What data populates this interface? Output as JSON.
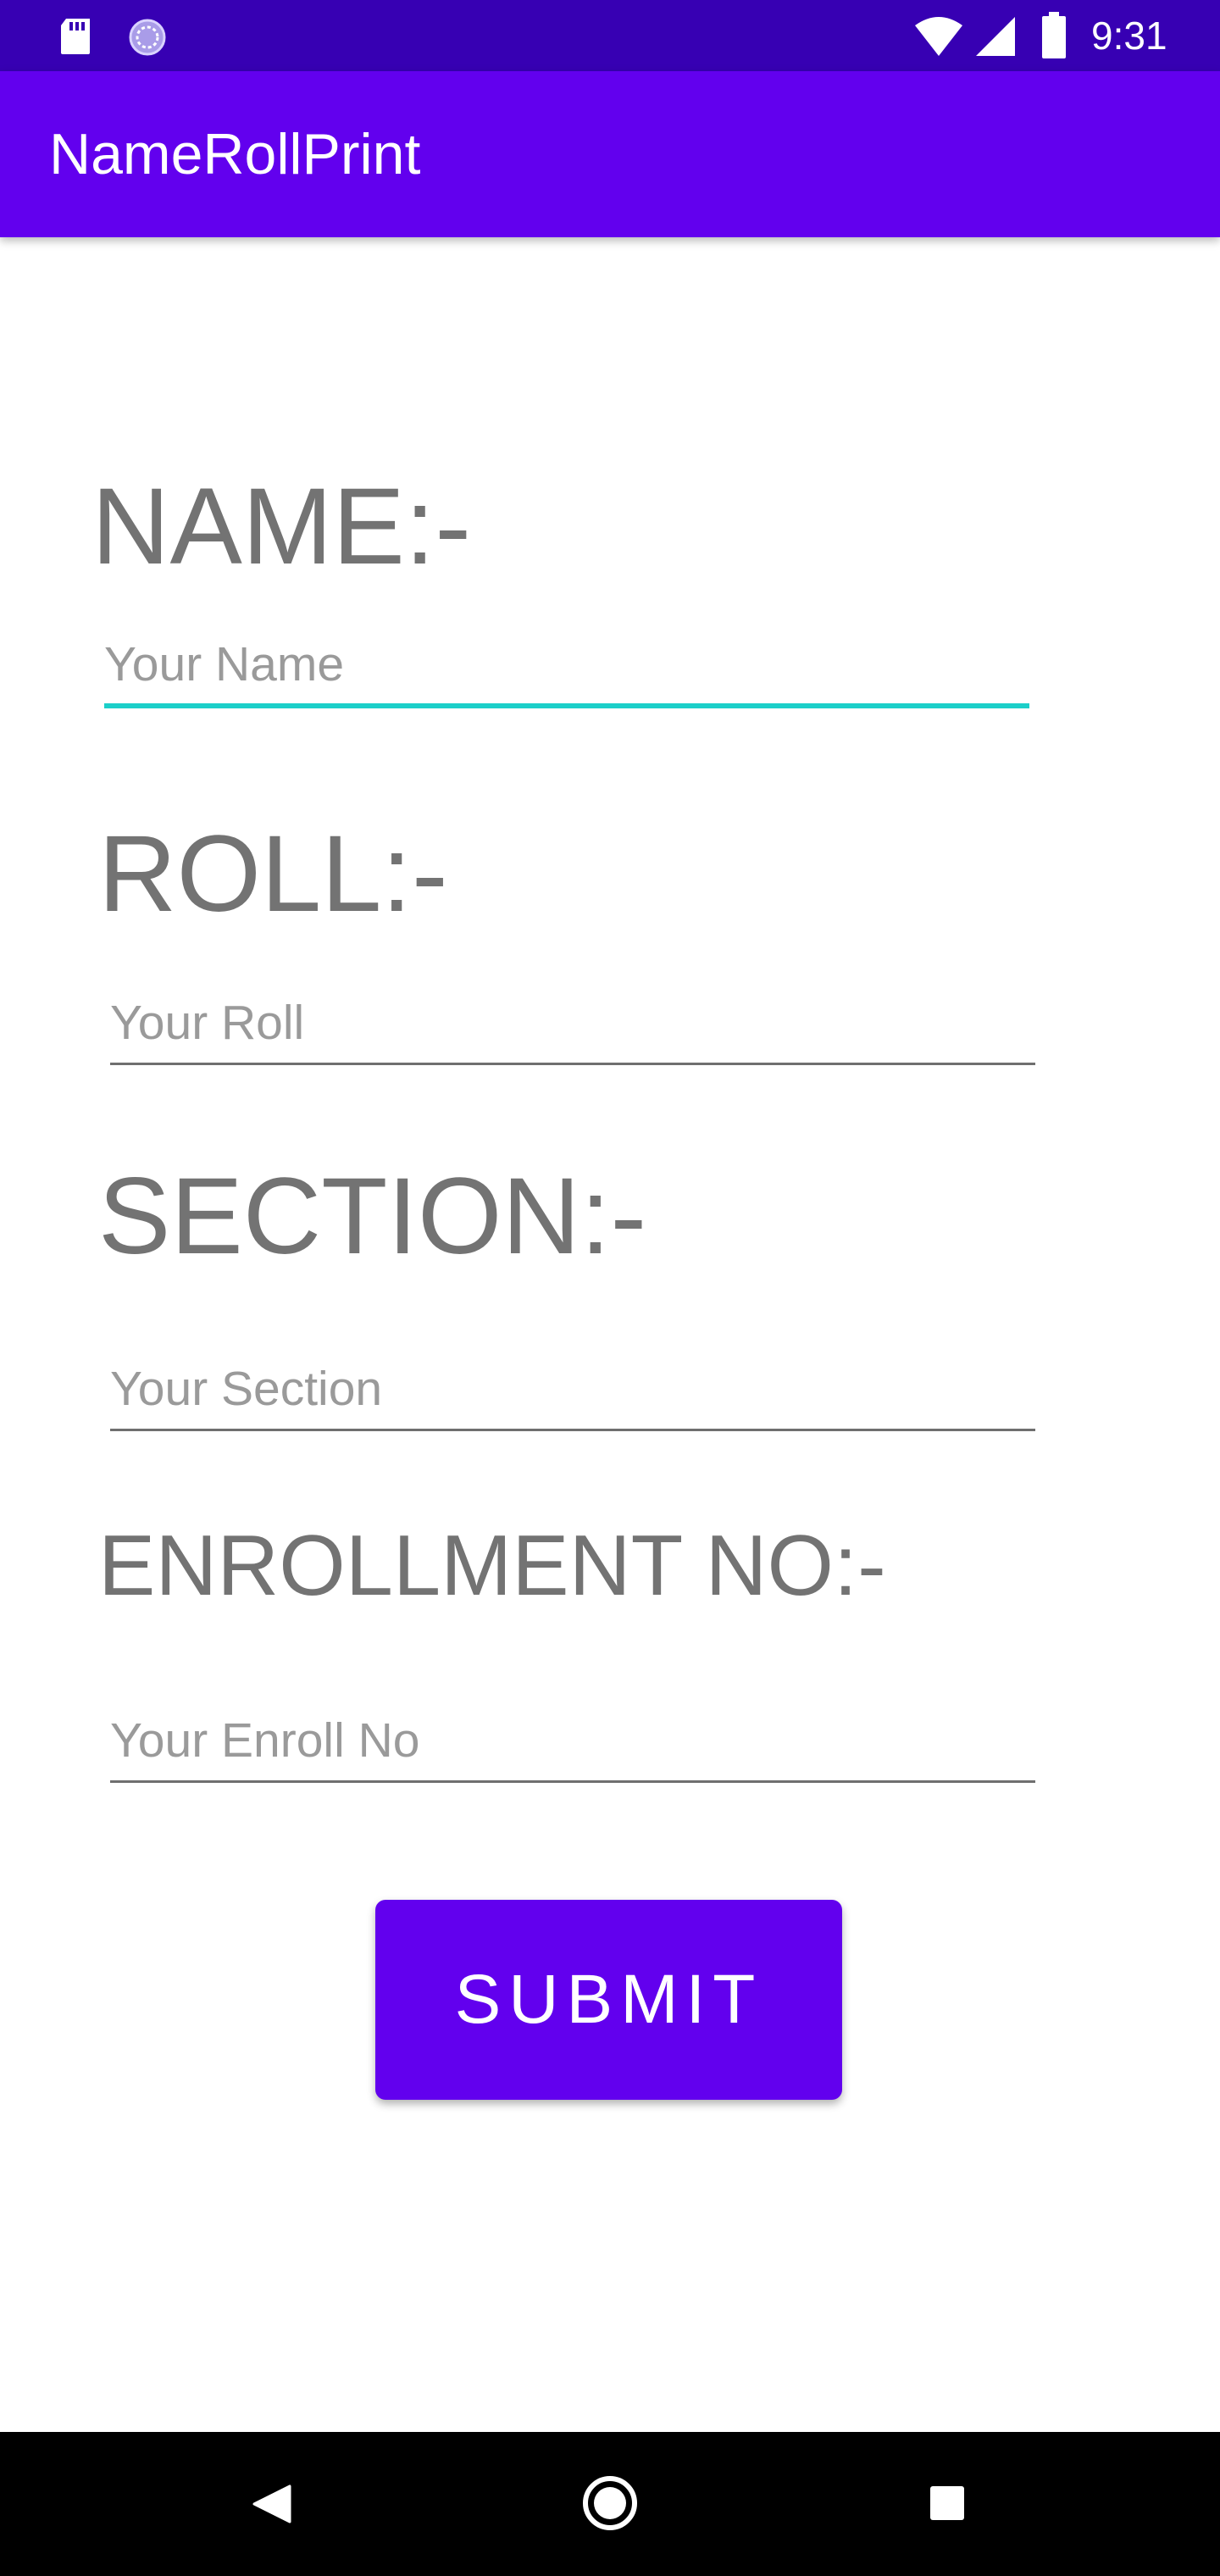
{
  "status_bar": {
    "time": "9:31",
    "icons": [
      "sd-card-icon",
      "loading-icon",
      "wifi-icon",
      "signal-icon",
      "battery-icon"
    ]
  },
  "app_bar": {
    "title": "NameRollPrint"
  },
  "form": {
    "name_label": "NAME:-",
    "name_placeholder": "Your Name",
    "roll_label": "ROLL:-",
    "roll_placeholder": "Your Roll",
    "section_label": "SECTION:-",
    "section_placeholder": "Your Section",
    "enrollment_label": "ENROLLMENT NO:-",
    "enrollment_placeholder": "Your Enroll No",
    "submit_label": "SUBMIT"
  },
  "nav_bar": {
    "buttons": [
      "back-icon",
      "home-icon",
      "recents-icon"
    ]
  },
  "colors": {
    "status_bar": "#3700b3",
    "primary": "#6200ee",
    "focus_underline": "#1ccfc9",
    "label_text": "#737373"
  }
}
